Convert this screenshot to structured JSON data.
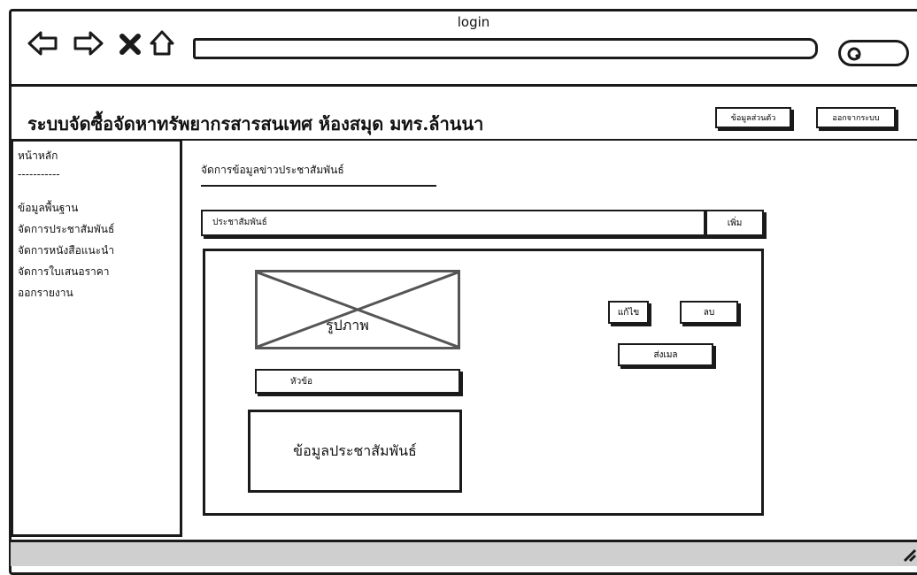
{
  "window": {
    "title": "login"
  },
  "browser": {
    "icons": [
      "back-arrow-icon",
      "forward-arrow-icon",
      "close-icon",
      "home-icon",
      "search-icon"
    ],
    "address_value": ""
  },
  "header": {
    "title": "ระบบจัดซื้อจัดหาทรัพยากรสารสนเทศ ห้องสมุด มทร.ล้านนา",
    "profile_label": "ข้อมูลส่วนตัว",
    "logout_label": "ออกจากระบบ"
  },
  "sidebar": {
    "items": [
      {
        "label": "หน้าหลัก"
      },
      {
        "label": "-----------"
      },
      {
        "label": "ข้อมูลพื้นฐาน"
      },
      {
        "label": "จัดการประชาสัมพันธ์"
      },
      {
        "label": "จัดการหนังสือแนะนำ"
      },
      {
        "label": "จัดการใบเสนอราคา"
      },
      {
        "label": "ออกรายงาน"
      }
    ]
  },
  "main": {
    "section_title": "จัดการข้อมูลข่าวประชาสัมพันธ์",
    "pr_bar_label": "ประชาสัมพันธ์",
    "add_label": "เพิ่ม",
    "image_label": "รูปภาพ",
    "headline_label": "หัวข้อ",
    "detail_label": "ข้อมูลประชาสัมพันธ์",
    "edit_label": "แก้ไข",
    "delete_label": "ลบ",
    "send_label": "ส่งเมล"
  }
}
